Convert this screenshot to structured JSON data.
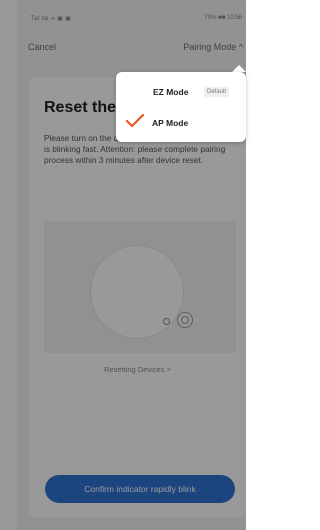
{
  "status_bar": {
    "left": "Tal tal ∞ ▣ ▣",
    "right": "70% ■■ 10:56"
  },
  "nav": {
    "cancel": "Cancel",
    "pairing_mode": "Pairing Mode ^"
  },
  "card": {
    "title": "Reset the",
    "instructions": "Please turn on the device and confirm that indicator is blinking fast. Attention: please complete pairing process within 3 minutes after device reset.",
    "caption": "Resetting Devices >",
    "confirm_button": "Confirm indicator rapidly blink"
  },
  "menu": {
    "ez_mode": "EZ Mode",
    "default_badge": "Default",
    "ap_mode": "AP Mode",
    "selected": "AP Mode",
    "check_color": "#e8552b"
  },
  "colors": {
    "primary": "#2f74d6",
    "overlay": "rgba(0,0,0,0.40)"
  }
}
